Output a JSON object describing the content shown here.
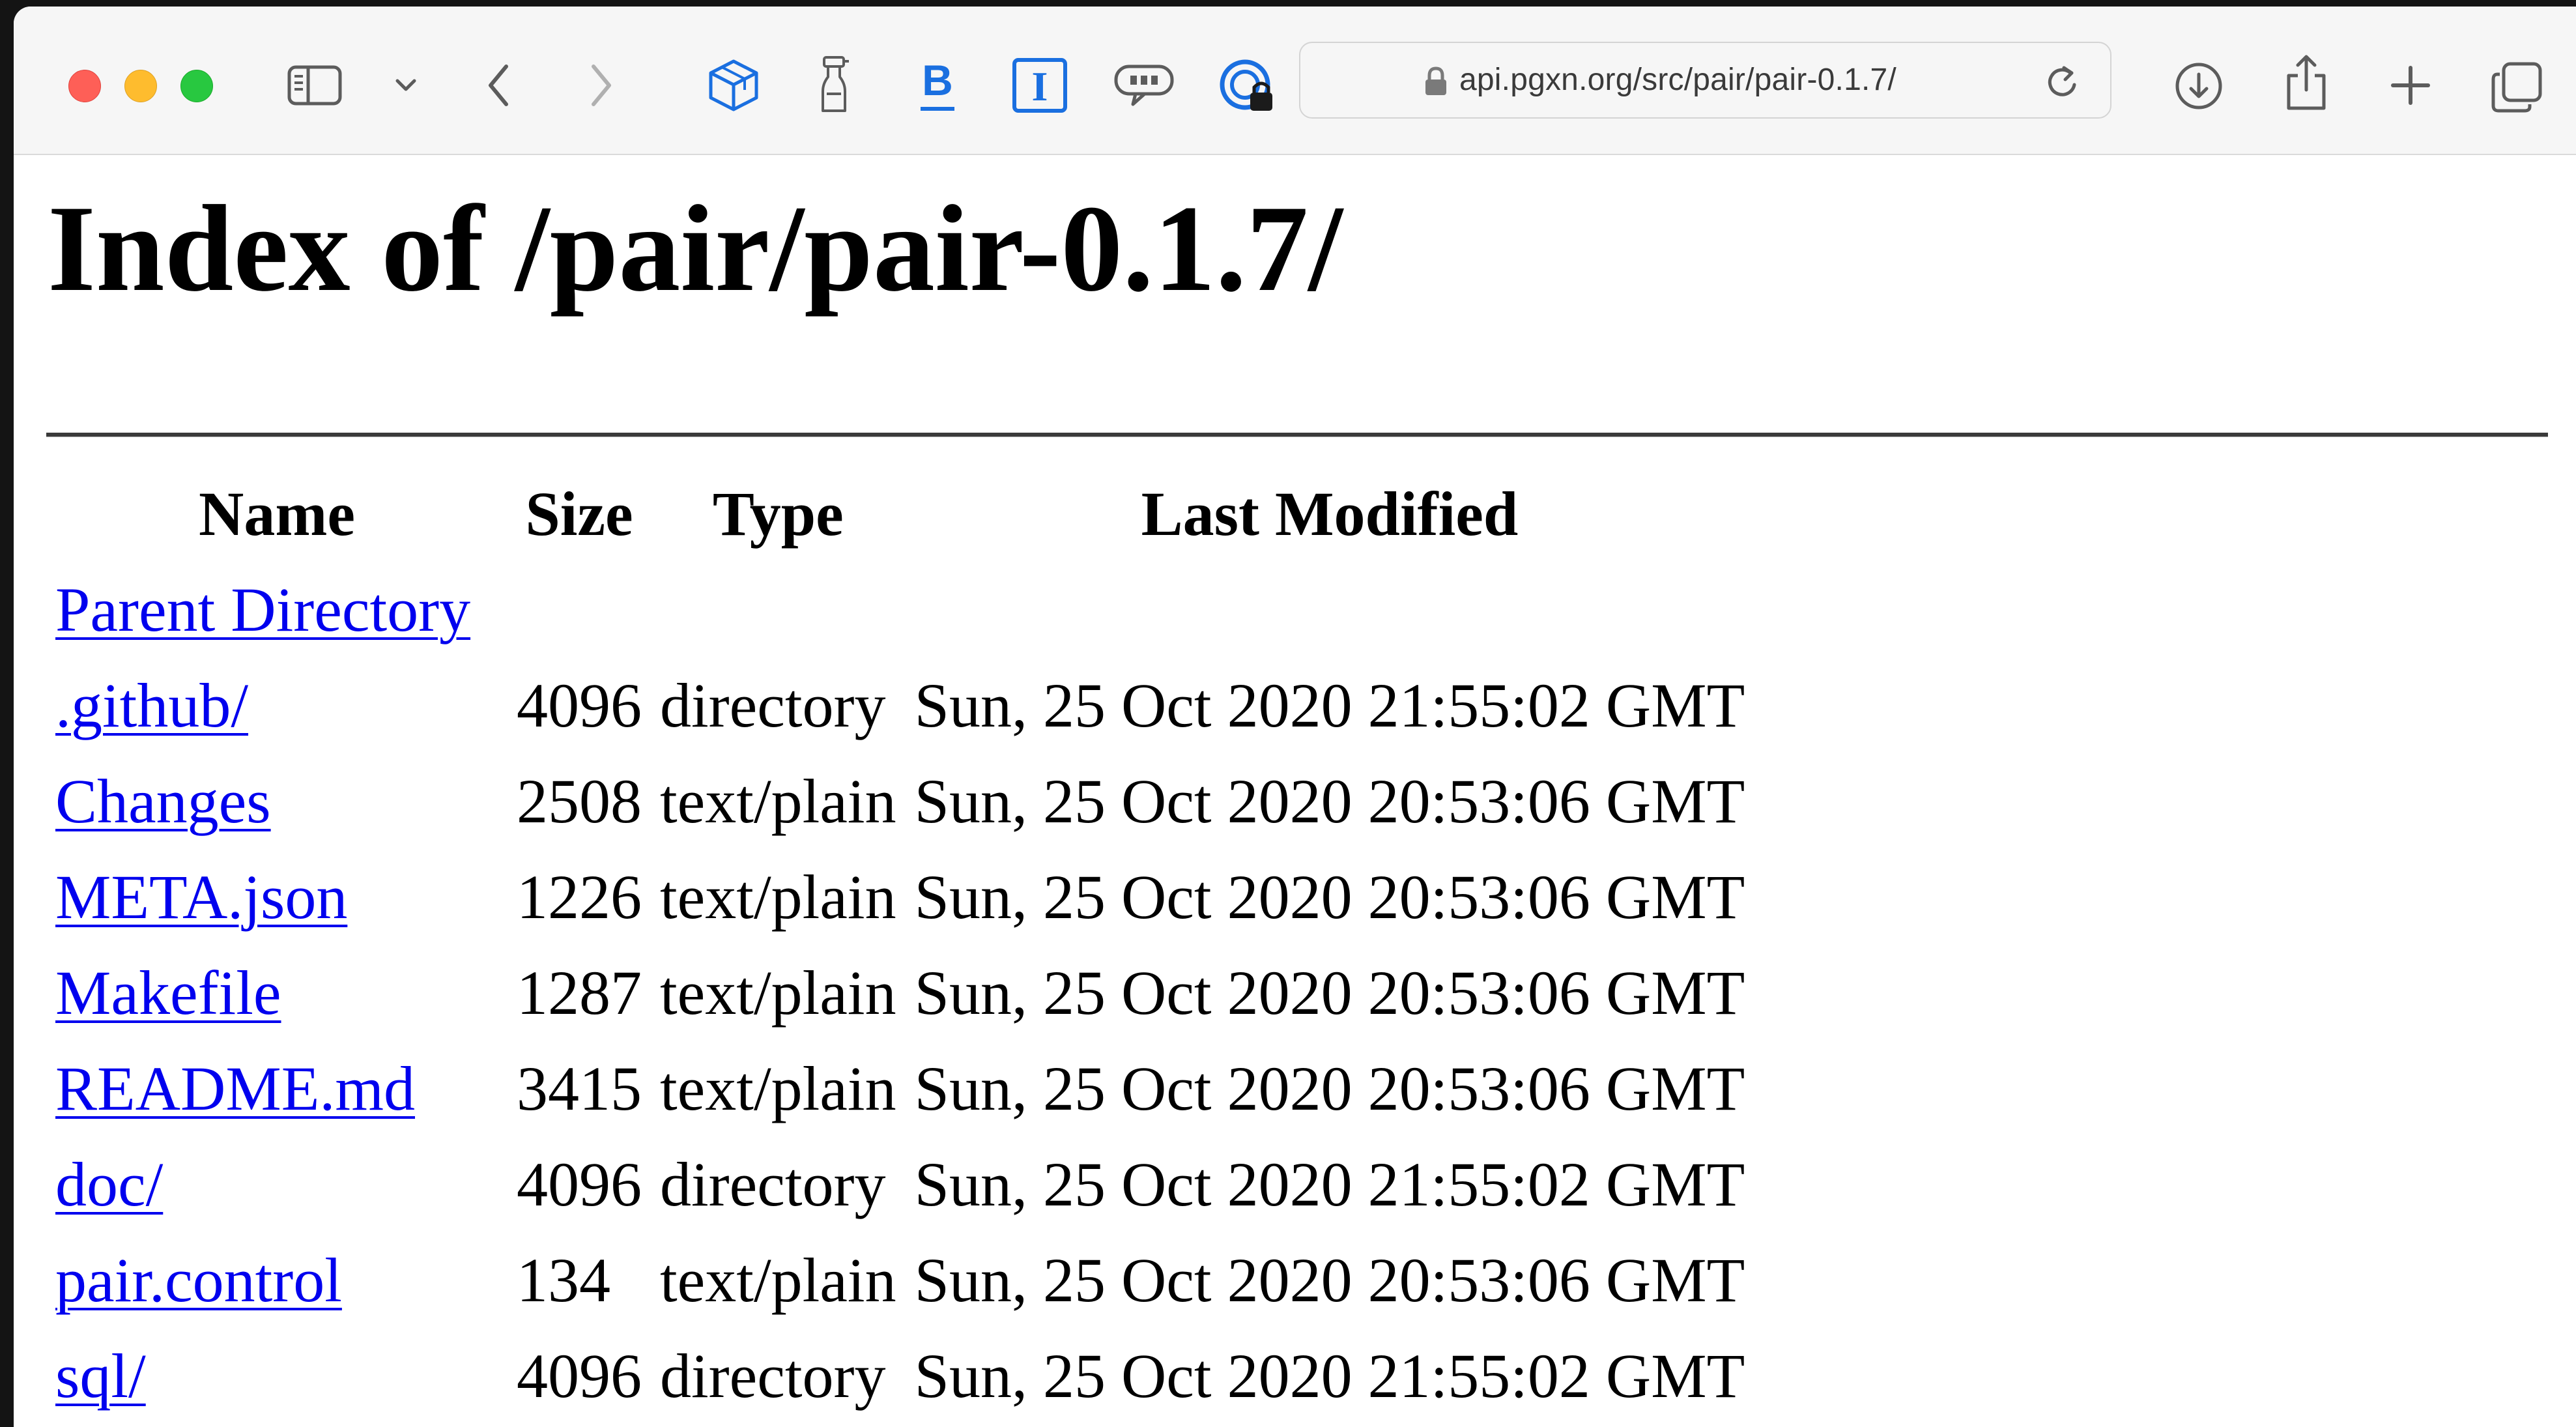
{
  "browser": {
    "url": "api.pgxn.org/src/pair/pair-0.1.7/",
    "accent_color": "#0c66e4"
  },
  "page": {
    "title": "Index of /pair/pair-0.1.7/",
    "columns": [
      "Name",
      "Size",
      "Type",
      "Last Modified"
    ],
    "parent_link": "Parent Directory",
    "link_color": "#0000ee",
    "rows": [
      {
        "name": ".github/",
        "size": "4096",
        "type": "directory",
        "modified": "Sun, 25 Oct 2020 21:55:02 GMT"
      },
      {
        "name": "Changes",
        "size": "2508",
        "type": "text/plain",
        "modified": "Sun, 25 Oct 2020 20:53:06 GMT"
      },
      {
        "name": "META.json",
        "size": "1226",
        "type": "text/plain",
        "modified": "Sun, 25 Oct 2020 20:53:06 GMT"
      },
      {
        "name": "Makefile",
        "size": "1287",
        "type": "text/plain",
        "modified": "Sun, 25 Oct 2020 20:53:06 GMT"
      },
      {
        "name": "README.md",
        "size": "3415",
        "type": "text/plain",
        "modified": "Sun, 25 Oct 2020 20:53:06 GMT"
      },
      {
        "name": "doc/",
        "size": "4096",
        "type": "directory",
        "modified": "Sun, 25 Oct 2020 21:55:02 GMT"
      },
      {
        "name": "pair.control",
        "size": "134",
        "type": "text/plain",
        "modified": "Sun, 25 Oct 2020 20:53:06 GMT"
      },
      {
        "name": "sql/",
        "size": "4096",
        "type": "directory",
        "modified": "Sun, 25 Oct 2020 21:55:02 GMT"
      }
    ]
  }
}
